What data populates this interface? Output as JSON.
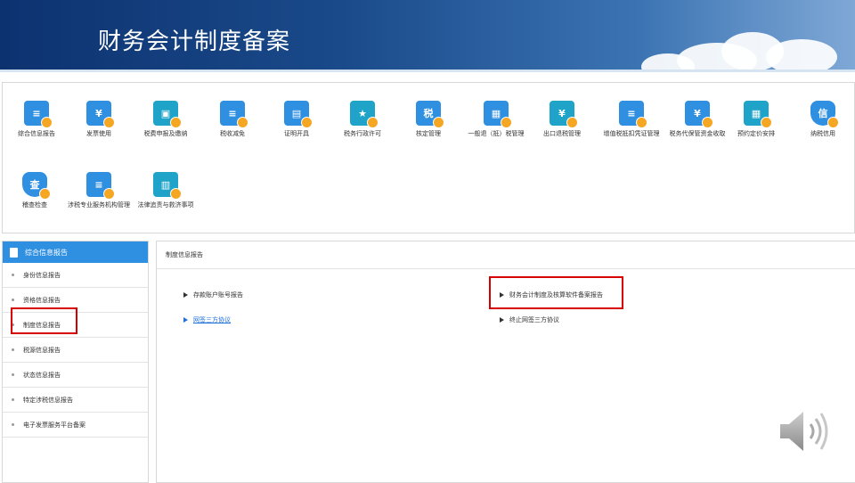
{
  "banner": {
    "title": "财务会计制度备案"
  },
  "toolbar": {
    "row1": [
      {
        "label": "综合信息报告",
        "icon": "document-person-icon",
        "glyph": "≡"
      },
      {
        "label": "发票使用",
        "icon": "invoice-icon",
        "glyph": "¥"
      },
      {
        "label": "税费申报及缴纳",
        "icon": "tax-declaration-icon",
        "glyph": "▣"
      },
      {
        "label": "税收减免",
        "icon": "tax-reduction-icon",
        "glyph": "≡"
      },
      {
        "label": "证明开具",
        "icon": "folder-certificate-icon",
        "glyph": "▤"
      },
      {
        "label": "税务行政许可",
        "icon": "administrative-permit-icon",
        "glyph": "★"
      },
      {
        "label": "核定管理",
        "icon": "tax-assessment-icon",
        "glyph": "税"
      },
      {
        "label": "一般退（抵）税管理",
        "icon": "tax-refund-icon",
        "glyph": "▦"
      },
      {
        "label": "出口退税管理",
        "icon": "export-refund-icon",
        "glyph": "¥"
      },
      {
        "label": "增值税抵扣凭证管理",
        "icon": "vat-voucher-icon",
        "glyph": "≡"
      },
      {
        "label": "税务代保管资金收取",
        "icon": "fund-custody-icon",
        "glyph": "¥"
      },
      {
        "label": "预约定价安排",
        "icon": "calendar-pricing-icon",
        "glyph": "▦"
      },
      {
        "label": "纳税信用",
        "icon": "credit-shield-icon",
        "glyph": "信"
      }
    ],
    "row2": [
      {
        "label": "稽查检查",
        "icon": "inspection-shield-icon",
        "glyph": "查"
      },
      {
        "label": "涉税专业服务机构管理",
        "icon": "agency-management-icon",
        "glyph": "≡"
      },
      {
        "label": "法律追责与救济事项",
        "icon": "legal-book-icon",
        "glyph": "▥"
      }
    ]
  },
  "sidebar": {
    "header": "综合信息报告",
    "items": [
      {
        "label": "身份信息报告"
      },
      {
        "label": "资格信息报告"
      },
      {
        "label": "制度信息报告"
      },
      {
        "label": "税源信息报告"
      },
      {
        "label": "状态信息报告"
      },
      {
        "label": "特定涉税信息报告"
      },
      {
        "label": "电子发票服务平台备案"
      }
    ]
  },
  "panel": {
    "header": "制度信息报告",
    "links": [
      {
        "label": "存款账户账号报告"
      },
      {
        "label": "财务会计制度及核算软件备案报告"
      },
      {
        "label": "网签三方协议"
      },
      {
        "label": "终止网签三方协议"
      }
    ]
  },
  "colors": {
    "banner": "#0d3270",
    "accent": "#2f8fe0",
    "highlight": "#d60000",
    "link": "#1e6fd9"
  }
}
